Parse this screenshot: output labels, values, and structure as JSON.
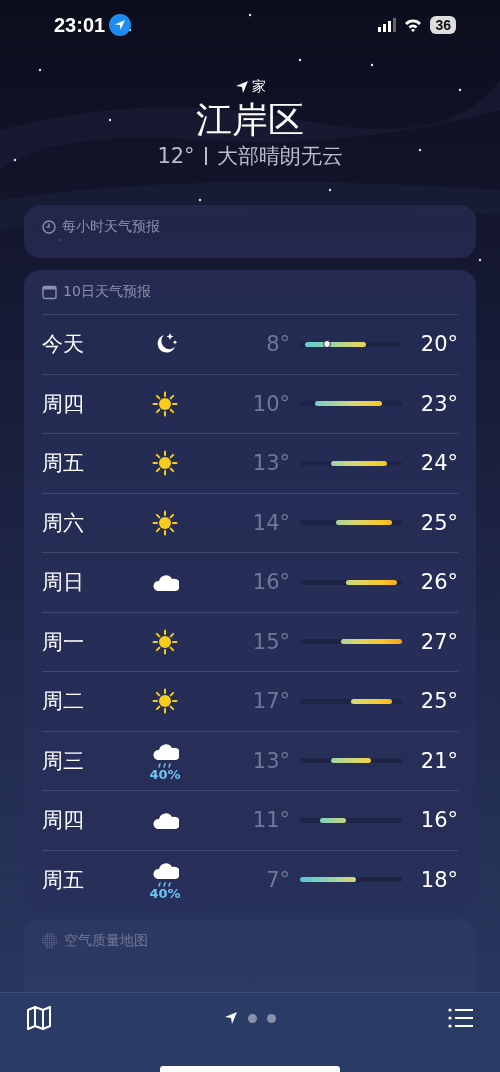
{
  "status_bar": {
    "time": "23:01",
    "battery": "36"
  },
  "header": {
    "home_label": "家",
    "city": "江岸区",
    "temperature": "12°",
    "condition": "大部晴朗无云"
  },
  "hourly_card": {
    "title": "每小时天气预报"
  },
  "daily_card": {
    "title": "10日天气预报",
    "rows": [
      {
        "day": "今天",
        "kind": "moon",
        "low": "8°",
        "high": "20°",
        "current_marker": true
      },
      {
        "day": "周四",
        "kind": "sun",
        "low": "10°",
        "high": "23°",
        "current_marker": false
      },
      {
        "day": "周五",
        "kind": "sun",
        "low": "13°",
        "high": "24°",
        "current_marker": false
      },
      {
        "day": "周六",
        "kind": "sun",
        "low": "14°",
        "high": "25°",
        "current_marker": false
      },
      {
        "day": "周日",
        "kind": "cloud",
        "low": "16°",
        "high": "26°",
        "current_marker": false
      },
      {
        "day": "周一",
        "kind": "sun",
        "low": "15°",
        "high": "27°",
        "current_marker": false
      },
      {
        "day": "周二",
        "kind": "sun",
        "low": "17°",
        "high": "25°",
        "current_marker": false
      },
      {
        "day": "周三",
        "kind": "rain",
        "precip": "40%",
        "low": "13°",
        "high": "21°",
        "current_marker": false
      },
      {
        "day": "周四",
        "kind": "cloud",
        "low": "11°",
        "high": "16°",
        "current_marker": false
      },
      {
        "day": "周五",
        "kind": "rain",
        "precip": "40%",
        "low": "7°",
        "high": "18°",
        "current_marker": false
      }
    ]
  },
  "air_card": {
    "title": "空气质量地图"
  },
  "bottom_bar": {
    "pages": [
      {
        "kind": "location",
        "selected": true
      },
      {
        "kind": "dot",
        "selected": false
      },
      {
        "kind": "dot",
        "selected": false
      }
    ]
  }
}
